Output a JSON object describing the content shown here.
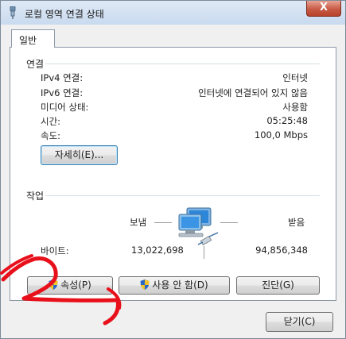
{
  "window": {
    "title": "로컬 영역 연결 상태",
    "close_glyph": "X"
  },
  "tabs": [
    {
      "label": "일반"
    }
  ],
  "connection": {
    "header": "연결",
    "rows": [
      {
        "label": "IPv4 연결:",
        "value": "인터넷"
      },
      {
        "label": "IPv6 연결:",
        "value": "인터넷에 연결되어 있지 않음"
      },
      {
        "label": "미디어 상태:",
        "value": "사용함"
      },
      {
        "label": "시간:",
        "value": "05:25:48"
      },
      {
        "label": "속도:",
        "value": "100,0 Mbps"
      }
    ],
    "details_button": "자세히(E)..."
  },
  "activity": {
    "header": "작업",
    "sent_label": "보냄",
    "received_label": "받음",
    "bytes_label": "바이트:",
    "bytes_sent": "13,022,698",
    "bytes_received": "94,856,348"
  },
  "buttons": {
    "properties": "속성(P)",
    "disable": "사용 안 함(D)",
    "diagnose": "진단(G)",
    "close": "닫기(C)"
  },
  "icons": {
    "title": "network-adapter-icon",
    "shield": "uac-shield-icon",
    "activity": "network-computers-icon"
  },
  "colors": {
    "annotation_red": "#e8101a",
    "titlebar": "#c9daef",
    "close_button": "#c75b45"
  }
}
